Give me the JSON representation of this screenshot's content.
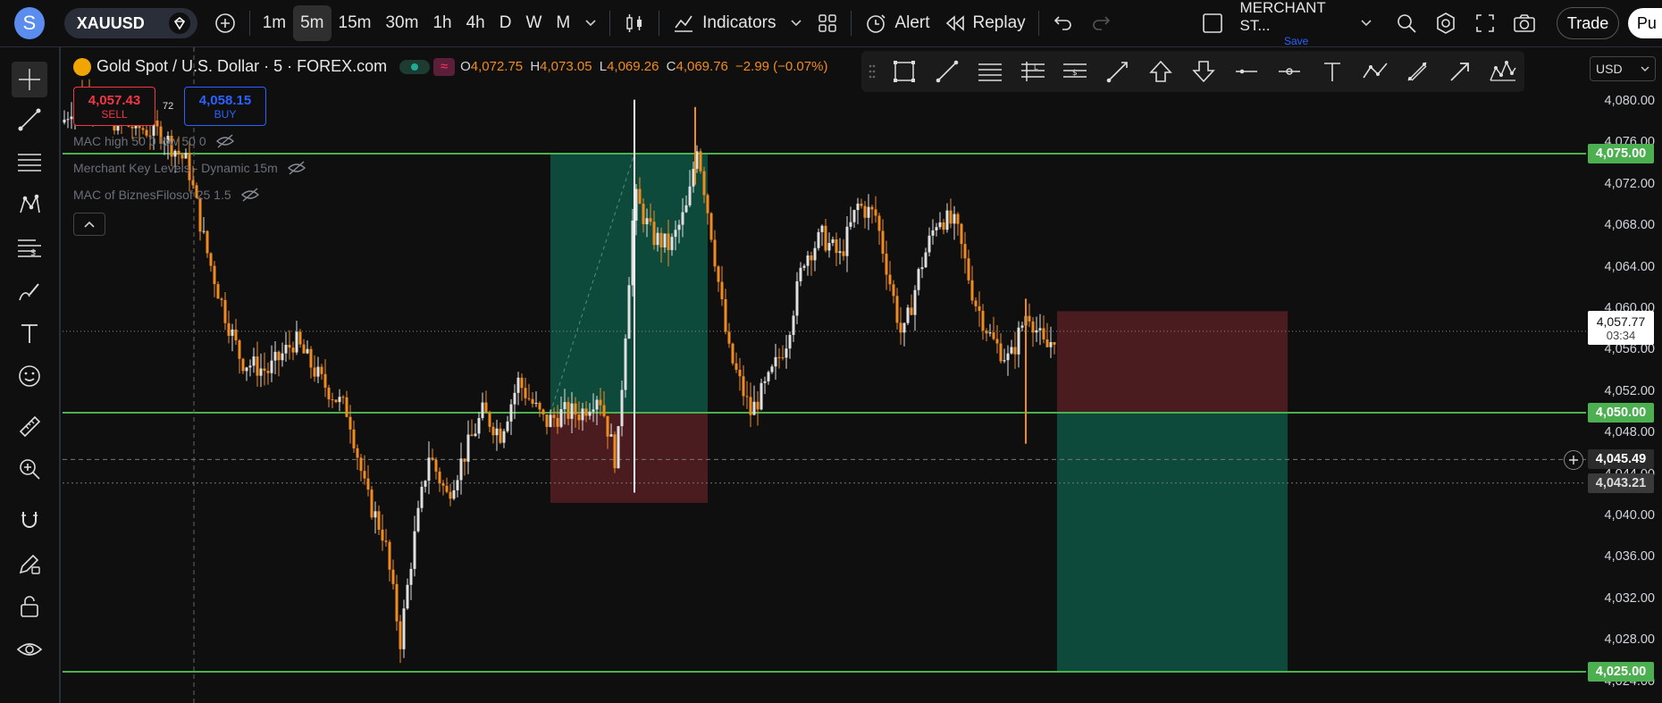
{
  "topbar": {
    "avatar_letter": "S",
    "symbol": "XAUUSD",
    "timeframes": [
      "1m",
      "5m",
      "15m",
      "30m",
      "1h",
      "4h",
      "D",
      "W",
      "M"
    ],
    "active_timeframe": "5m",
    "indicators_label": "Indicators",
    "alert_label": "Alert",
    "replay_label": "Replay",
    "layout_name": "MERCHANT ST...",
    "layout_save": "Save",
    "trade_label": "Trade",
    "publish_label": "Pu"
  },
  "legend": {
    "title": "Gold Spot / U.S. Dollar · 5 · FOREX.com",
    "open_label": "O",
    "open": "4,072.75",
    "high_label": "H",
    "high": "4,073.05",
    "low_label": "L",
    "low": "4,069.26",
    "close_label": "C",
    "close": "4,069.76",
    "change": "−2.99 (−0.07%)",
    "sell_price": "4,057.43",
    "sell_label": "SELL",
    "spread": "72",
    "buy_price": "4,058.15",
    "buy_label": "BUY",
    "indicators": [
      "MAC high 50 0 low 50 0",
      "Merchant Key Levels - Dynamic 15m",
      "MAC of BiznesFilosof 25 1.5"
    ]
  },
  "price_axis": {
    "currency": "USD",
    "ticks": [
      "4,080.00",
      "4,076.00",
      "4,072.00",
      "4,068.00",
      "4,064.00",
      "4,060.00",
      "4,056.00",
      "4,052.00",
      "4,048.00",
      "4,044.00",
      "4,040.00",
      "4,036.00",
      "4,032.00",
      "4,028.00",
      "4,024.00"
    ],
    "level_tags": [
      "4,075.00",
      "4,050.00",
      "4,025.00"
    ],
    "current_price": "4,057.77",
    "countdown": "03:34",
    "crosshair_price": "4,045.49",
    "dotted_price": "4,043.21"
  },
  "colors": {
    "bg": "#0f0f0f",
    "level_green": "#4caf50",
    "profit_zone": "#0d4a3c",
    "loss_zone": "#4a1b1f",
    "candle_up": "#e0e0e0",
    "candle_down": "#f08c1e",
    "sell_red": "#f23645",
    "buy_blue": "#2962ff"
  },
  "icons": {
    "left_toolbar": [
      "crosshair-icon",
      "trendline-icon",
      "fib-icon",
      "pattern-icon",
      "long-position-icon",
      "brush-icon",
      "text-icon",
      "emoji-icon",
      "ruler-icon",
      "zoom-in-icon",
      "magnet-icon",
      "pencil-lock-icon",
      "lock-icon",
      "eye-icon"
    ],
    "draw_toolbar": [
      "rectangle-icon",
      "line-icon",
      "horizontal-lines-icon",
      "fib-levels-icon",
      "price-levels-icon",
      "ray-icon",
      "arrow-up-icon",
      "arrow-down-icon",
      "horizontal-line-icon",
      "horizontal-ray-icon",
      "text-tool-icon",
      "path-icon",
      "brush-tool-icon",
      "arrow-marker-icon",
      "pattern-tool-icon"
    ]
  }
}
